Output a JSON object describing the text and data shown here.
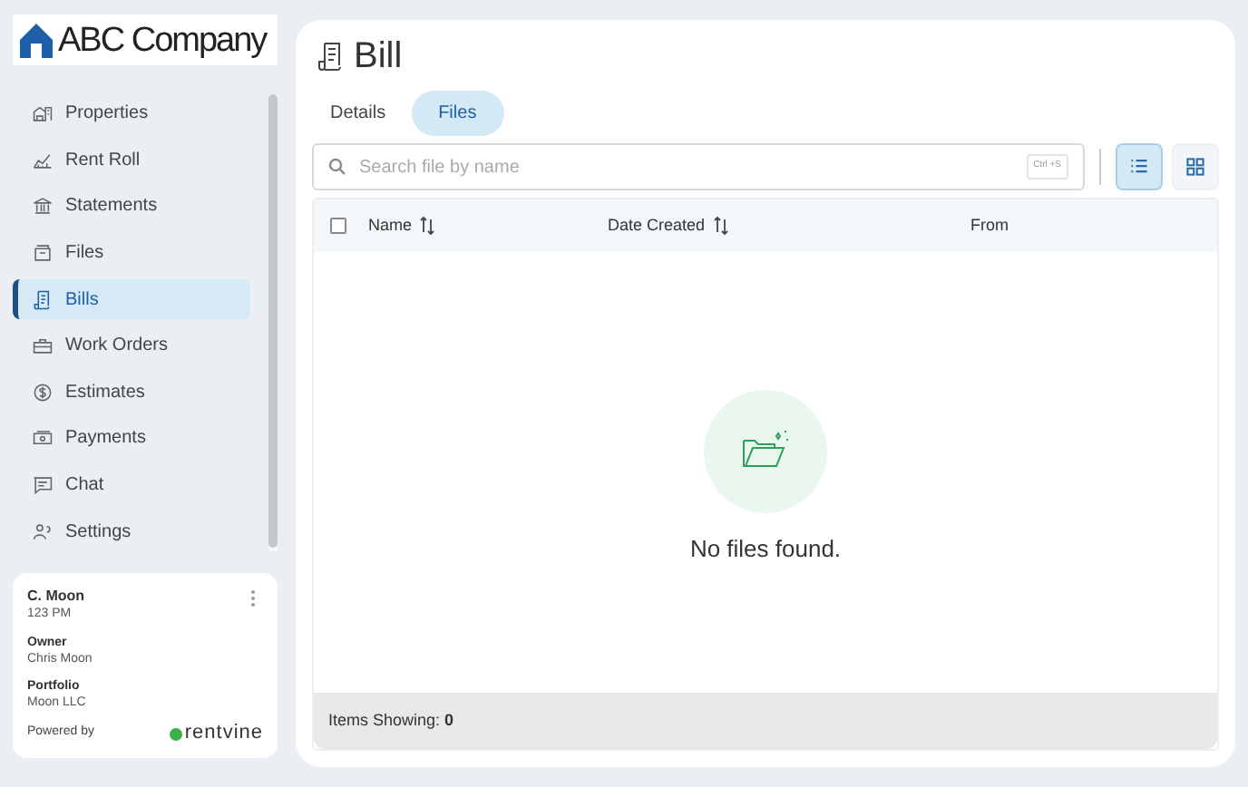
{
  "logo": {
    "text": "ABC Company"
  },
  "sidebar": {
    "items": [
      {
        "label": "Properties",
        "selected": false
      },
      {
        "label": "Rent Roll",
        "selected": false
      },
      {
        "label": "Statements",
        "selected": false
      },
      {
        "label": "Files",
        "selected": false
      },
      {
        "label": "Bills",
        "selected": true
      },
      {
        "label": "Work Orders",
        "selected": false
      },
      {
        "label": "Estimates",
        "selected": false
      },
      {
        "label": "Payments",
        "selected": false
      },
      {
        "label": "Chat",
        "selected": false
      },
      {
        "label": "Settings",
        "selected": false
      }
    ]
  },
  "user_card": {
    "name": "C. Moon",
    "time": "123 PM",
    "fields": [
      {
        "label": "Owner",
        "value": "Chris Moon"
      },
      {
        "label": "Portfolio",
        "value": "Moon LLC"
      }
    ],
    "powered_by": "Powered by",
    "brand": "rentvine"
  },
  "page": {
    "title": "Bill",
    "tabs": [
      {
        "label": "Details",
        "selected": false
      },
      {
        "label": "Files",
        "selected": true
      }
    ],
    "search": {
      "placeholder": "Search file by name",
      "shortcut": "Ctrl +S"
    },
    "view_toggle": [
      {
        "kind": "list",
        "selected": true
      },
      {
        "kind": "grid",
        "selected": false
      }
    ],
    "table": {
      "select_all": {
        "checked": false
      },
      "columns": [
        {
          "label": "Name",
          "sortable": true
        },
        {
          "label": "Date Created",
          "sortable": true
        },
        {
          "label": "From",
          "sortable": false
        }
      ],
      "empty_message": "No files found."
    },
    "status_bar": "Items Showing: **0**"
  }
}
